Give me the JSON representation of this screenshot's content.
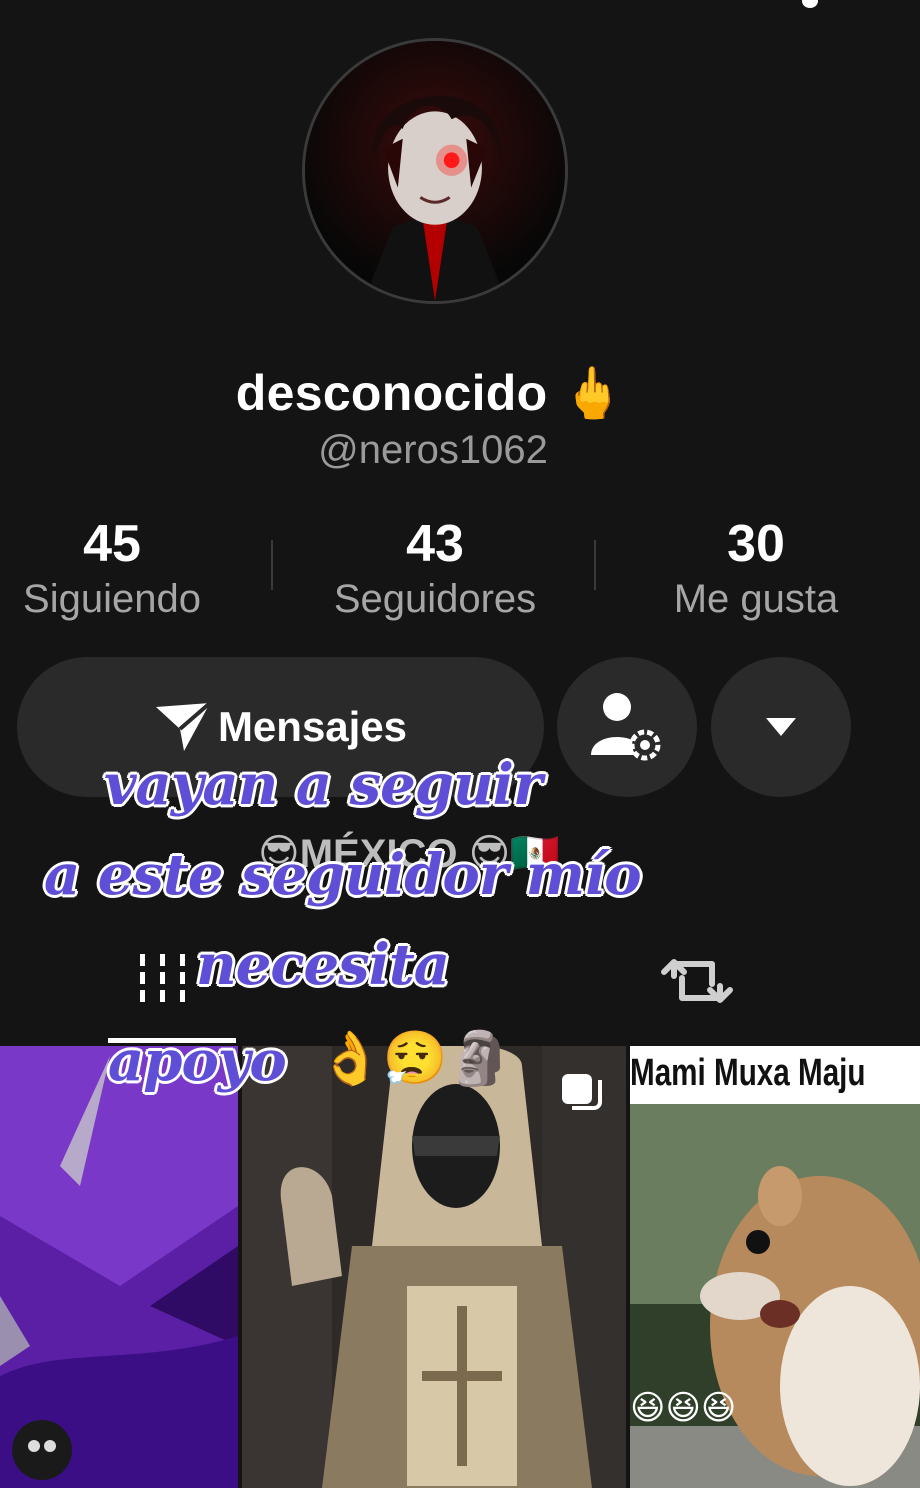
{
  "profile": {
    "display_name": "desconocido",
    "name_emoji": "🖕",
    "handle": "@neros1062",
    "region": "😎MÉXICO 😎🇲🇽"
  },
  "stats": [
    {
      "value": "45",
      "label": "Siguiendo"
    },
    {
      "value": "43",
      "label": "Seguidores"
    },
    {
      "value": "30",
      "label": "Me gusta"
    }
  ],
  "actions": {
    "messages_label": "Mensajes",
    "messages_icon": "send-icon",
    "friends_icon": "person-settings-icon",
    "more_icon": "caret-down-icon"
  },
  "tabs": [
    {
      "icon": "grid-icon",
      "active": true
    },
    {
      "icon": "repost-icon",
      "active": false
    }
  ],
  "thumbnails": [
    {
      "id": "purple-car"
    },
    {
      "id": "masked-knight"
    },
    {
      "caption": "Mami Muxa Maju",
      "emojis": "😆😆😆"
    }
  ],
  "overlay_text": {
    "line1": "vayan a seguir",
    "line2": "a este seguidor mío",
    "line3": "necesita",
    "line4": "apoyo",
    "emojis": "👌😮‍💨🗿"
  },
  "colors": {
    "background": "#141414",
    "button": "#2a2a2a",
    "overlay_text": "#5f4fd6"
  }
}
